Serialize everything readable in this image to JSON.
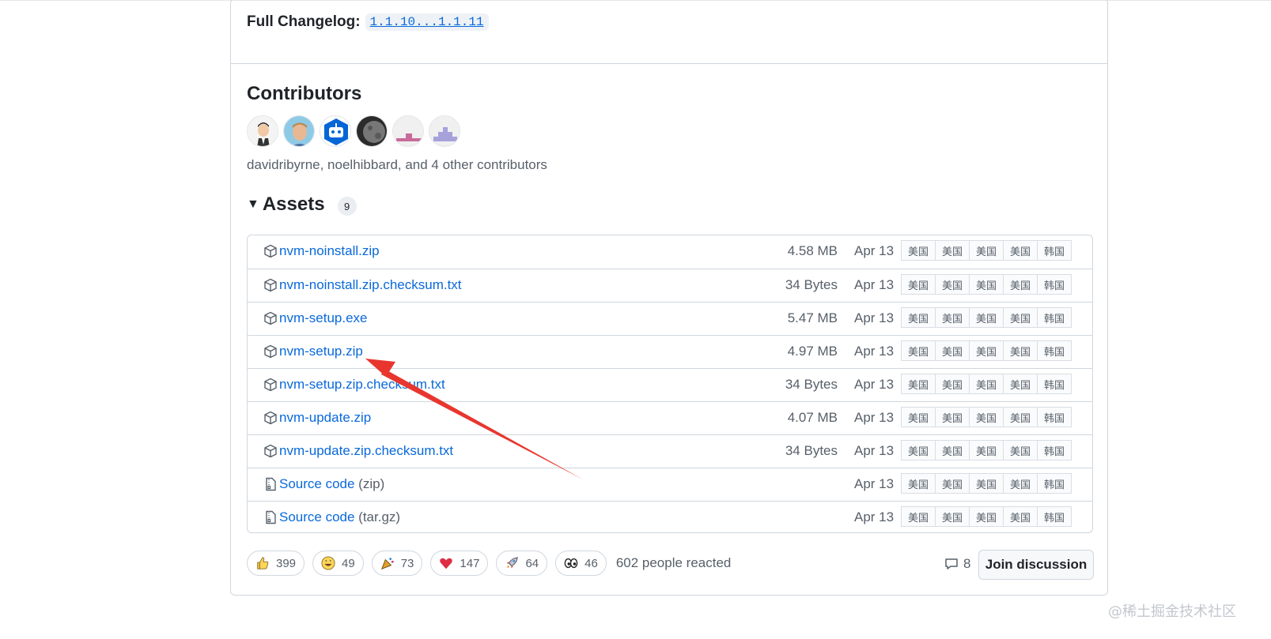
{
  "changelog": {
    "label": "Full Changelog:",
    "range": "1.1.10...1.1.11"
  },
  "contributors": {
    "title": "Contributors",
    "avatars": [
      "archer-avatar",
      "person-avatar",
      "bot-avatar",
      "moon-avatar",
      "pink-identicon-avatar",
      "purple-identicon-avatar"
    ],
    "summary": "davidribyrne, noelhibbard, and 4 other contributors"
  },
  "assets": {
    "title": "Assets",
    "count": "9",
    "rows": [
      {
        "name": "nvm-noinstall.zip",
        "ext": "",
        "size": "4.58 MB",
        "date": "Apr 13",
        "mirrors": [
          "美国",
          "美国",
          "美国",
          "美国",
          "韩国"
        ]
      },
      {
        "name": "nvm-noinstall.zip.checksum.txt",
        "ext": "",
        "size": "34 Bytes",
        "date": "Apr 13",
        "mirrors": [
          "美国",
          "美国",
          "美国",
          "美国",
          "韩国"
        ]
      },
      {
        "name": "nvm-setup.exe",
        "ext": "",
        "size": "5.47 MB",
        "date": "Apr 13",
        "mirrors": [
          "美国",
          "美国",
          "美国",
          "美国",
          "韩国"
        ]
      },
      {
        "name": "nvm-setup.zip",
        "ext": "",
        "size": "4.97 MB",
        "date": "Apr 13",
        "mirrors": [
          "美国",
          "美国",
          "美国",
          "美国",
          "韩国"
        ]
      },
      {
        "name": "nvm-setup.zip.checksum.txt",
        "ext": "",
        "size": "34 Bytes",
        "date": "Apr 13",
        "mirrors": [
          "美国",
          "美国",
          "美国",
          "美国",
          "韩国"
        ]
      },
      {
        "name": "nvm-update.zip",
        "ext": "",
        "size": "4.07 MB",
        "date": "Apr 13",
        "mirrors": [
          "美国",
          "美国",
          "美国",
          "美国",
          "韩国"
        ]
      },
      {
        "name": "nvm-update.zip.checksum.txt",
        "ext": "",
        "size": "34 Bytes",
        "date": "Apr 13",
        "mirrors": [
          "美国",
          "美国",
          "美国",
          "美国",
          "韩国"
        ]
      },
      {
        "name": "Source code",
        "ext": " (zip)",
        "size": "",
        "date": "Apr 13",
        "mirrors": [
          "美国",
          "美国",
          "美国",
          "美国",
          "韩国"
        ]
      },
      {
        "name": "Source code",
        "ext": " (tar.gz)",
        "size": "",
        "date": "Apr 13",
        "mirrors": [
          "美国",
          "美国",
          "美国",
          "美国",
          "韩国"
        ]
      }
    ]
  },
  "reactions": [
    {
      "emoji": "thumbs-up",
      "count": "399"
    },
    {
      "emoji": "laugh",
      "count": "49"
    },
    {
      "emoji": "hooray",
      "count": "73"
    },
    {
      "emoji": "heart",
      "count": "147"
    },
    {
      "emoji": "rocket",
      "count": "64"
    },
    {
      "emoji": "eyes",
      "count": "46"
    }
  ],
  "reacted_text": "602 people reacted",
  "comments_count": "8",
  "join_label": "Join discussion",
  "watermark": "@稀土掘金技术社区",
  "colors": {
    "link": "#0969da",
    "muted": "#57606a",
    "border": "#d0d7de",
    "arrow": "#e8362f"
  }
}
